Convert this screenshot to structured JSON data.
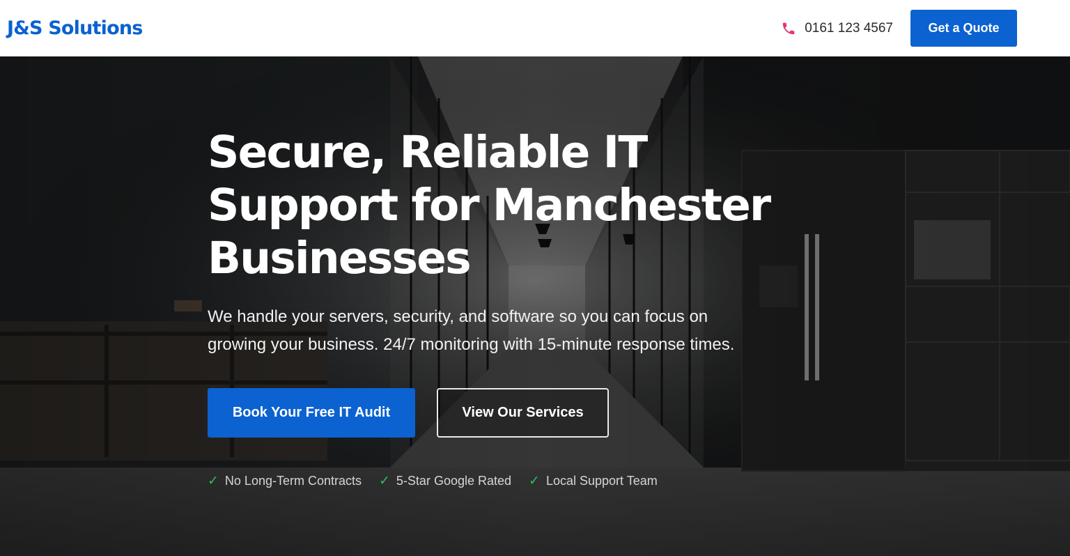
{
  "header": {
    "logo": "J&S Solutions",
    "phone": "0161 123 4567",
    "quote_button": "Get a Quote",
    "phone_icon": "phone-icon"
  },
  "hero": {
    "headline": "Secure, Reliable IT Support for Manchester Businesses",
    "subheadline": "We handle your servers, security, and software so you can focus on growing your business. 24/7 monitoring with 15-minute response times.",
    "primary_cta": "Book Your Free IT Audit",
    "secondary_cta": "View Our Services",
    "trust_items": [
      {
        "icon": "check-icon",
        "label": "No Long-Term Contracts"
      },
      {
        "icon": "check-icon",
        "label": "5-Star Google Rated"
      },
      {
        "icon": "check-icon",
        "label": "Local Support Team"
      }
    ]
  },
  "colors": {
    "brand_blue": "#0b62d0",
    "phone_icon": "#e8336d",
    "check_green": "#22c55e"
  }
}
